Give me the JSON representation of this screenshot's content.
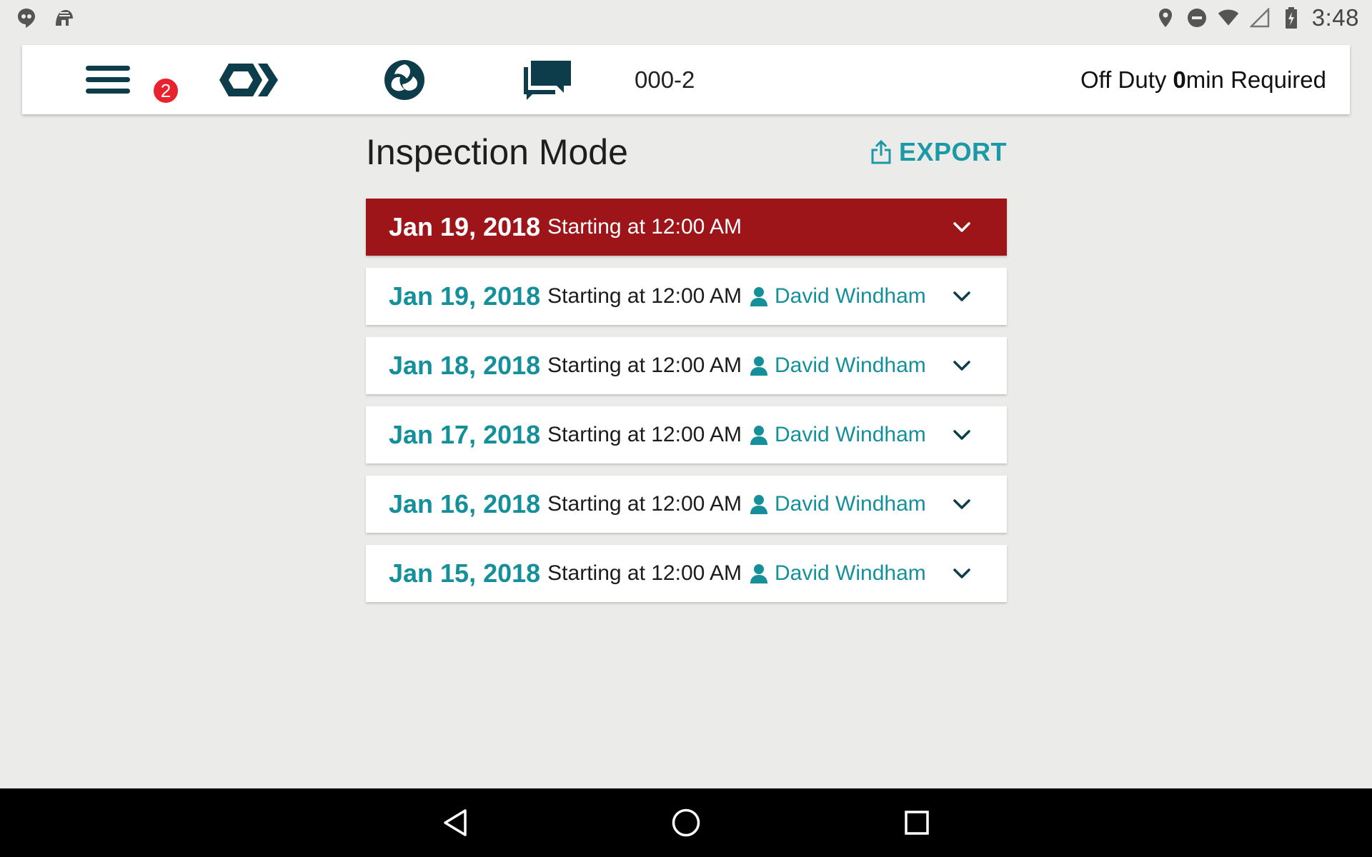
{
  "status_bar": {
    "time": "3:48",
    "left_icons": [
      "hangouts-icon",
      "spartan-helmet-icon"
    ],
    "right_icons": [
      "location-pin-icon",
      "do-not-disturb-icon",
      "wifi-icon",
      "cell-signal-icon",
      "battery-charging-icon"
    ]
  },
  "toolbar": {
    "menu_badge": "2",
    "vehicle_id": "000-2",
    "duty_status": "Off Duty",
    "duty_minutes": "0",
    "duty_suffix": "min Required"
  },
  "page": {
    "title": "Inspection Mode",
    "export_label": "EXPORT"
  },
  "logs": [
    {
      "date": "Jan 19, 2018",
      "start": "Starting at 12:00 AM",
      "driver": "",
      "active": true
    },
    {
      "date": "Jan 19, 2018",
      "start": "Starting at 12:00 AM",
      "driver": "David Windham",
      "active": false
    },
    {
      "date": "Jan 18, 2018",
      "start": "Starting at 12:00 AM",
      "driver": "David Windham",
      "active": false
    },
    {
      "date": "Jan 17, 2018",
      "start": "Starting at 12:00 AM",
      "driver": "David Windham",
      "active": false
    },
    {
      "date": "Jan 16, 2018",
      "start": "Starting at 12:00 AM",
      "driver": "David Windham",
      "active": false
    },
    {
      "date": "Jan 15, 2018",
      "start": "Starting at 12:00 AM",
      "driver": "David Windham",
      "active": false
    }
  ],
  "colors": {
    "accent": "#15909b",
    "active_row": "#9e1519",
    "badge": "#e8232e",
    "icon_dark": "#0d3d4a"
  }
}
